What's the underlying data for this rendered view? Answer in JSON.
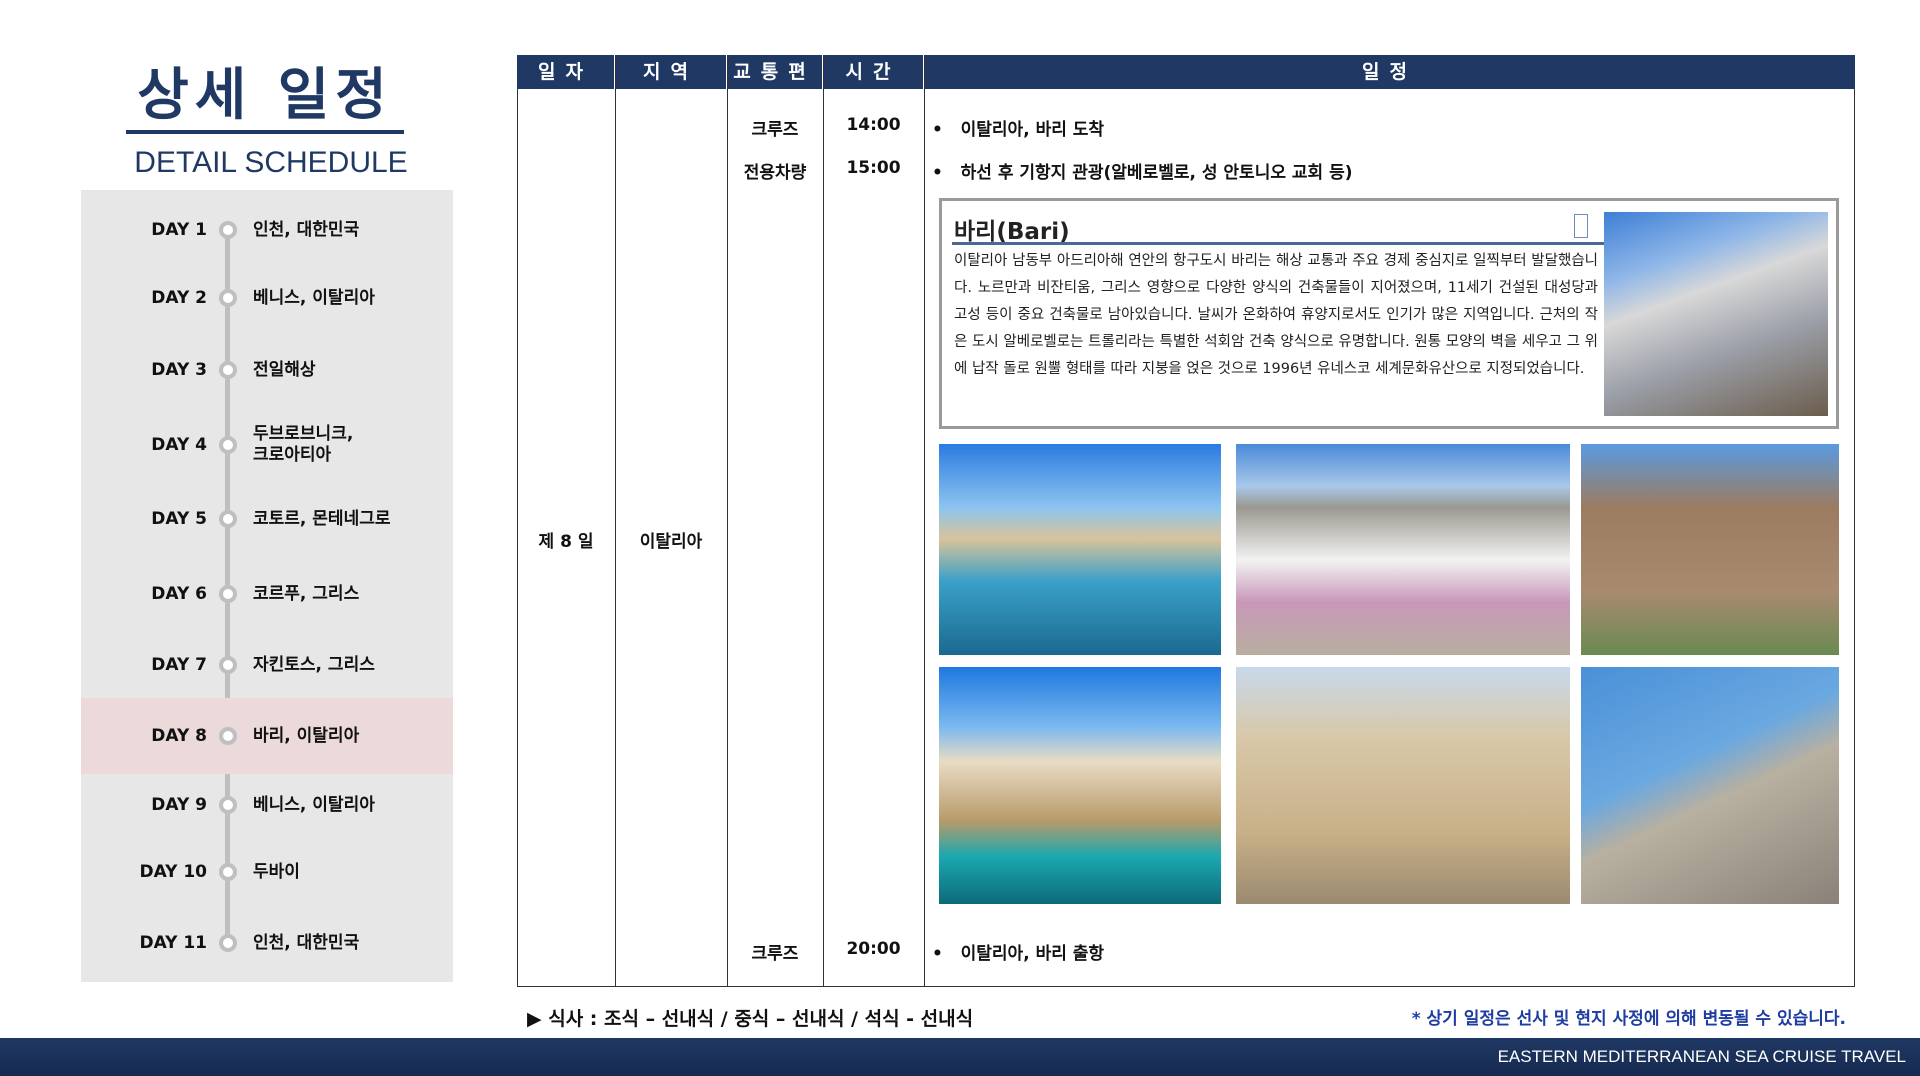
{
  "header": {
    "title": "상세 일정",
    "subtitle": "DETAIL SCHEDULE"
  },
  "sidebar": {
    "selected": "DAY 8",
    "days": [
      {
        "day": "DAY 1",
        "place": "인천, 대한민국"
      },
      {
        "day": "DAY 2",
        "place": "베니스, 이탈리아"
      },
      {
        "day": "DAY 3",
        "place": "전일해상"
      },
      {
        "day": "DAY 4",
        "place": "두브로브니크,\n크로아티아"
      },
      {
        "day": "DAY 5",
        "place": "코토르, 몬테네그로"
      },
      {
        "day": "DAY 6",
        "place": "코르푸, 그리스"
      },
      {
        "day": "DAY 7",
        "place": "자킨토스, 그리스"
      },
      {
        "day": "DAY 8",
        "place": "바리, 이탈리아"
      },
      {
        "day": "DAY 9",
        "place": "베니스, 이탈리아"
      },
      {
        "day": "DAY 10",
        "place": "두바이"
      },
      {
        "day": "DAY 11",
        "place": "인천, 대한민국"
      }
    ]
  },
  "table": {
    "headers": [
      "일자",
      "지역",
      "교통편",
      "시간",
      "일정"
    ],
    "date": "제 8 일",
    "region": "이탈리아",
    "rows": [
      {
        "transport": "크루즈",
        "time": "14:00",
        "item": "이탈리아, 바리 도착"
      },
      {
        "transport": "전용차량",
        "time": "15:00",
        "item": "하선 후 기항지 관광(알베로벨로, 성 안토니오 교회 등)"
      },
      {
        "transport": "크루즈",
        "time": "20:00",
        "item": "이탈리아, 바리 출항"
      }
    ],
    "bullet": "•",
    "info": {
      "title": "바리(Bari)",
      "text": "이탈리아 남동부 아드리아해 연안의 항구도시 바리는 해상 교통과 주요 경제 중심지로 일찍부터 발달했습니다. 노르만과 비잔티움, 그리스 영향으로 다양한 양식의 건축물들이 지어졌으며, 11세기 건설된 대성당과 고성 등이 중요 건축물로 남아있습니다. 날씨가 온화하여 휴양지로서도 인기가 많은 지역입니다. 근처의 작은 도시 알베로벨로는 트롤리라는 특별한 석회암 건축 양식으로 유명합니다. 원통 모양의 벽을 세우고 그 위에 납작 돌로 원뿔 형태를 따라 지붕을 얹은 것으로 1996년 유네스코 세계문화유산으로 지정되었습니다."
    }
  },
  "footer": {
    "meal": "▶ 식사 : 조식 – 선내식 / 중식 – 선내식 / 석식 - 선내식",
    "note": "* 상기 일정은 선사 및 현지 사정에 의해 변동될 수 있습니다.",
    "bar_text": "EASTERN MEDITERRANEAN SEA CRUISE TRAVEL"
  },
  "colors": {
    "navy": "#1f3864",
    "highlight": "#ecd9d9",
    "note": "#1f3ca0"
  }
}
